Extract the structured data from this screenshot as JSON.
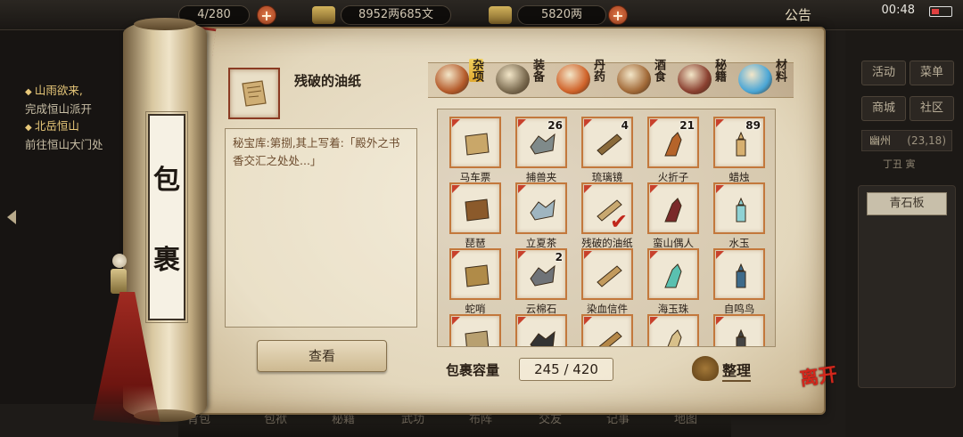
{
  "topbar": {
    "bag_count": "4/280",
    "money": "8952两685文",
    "gold": "5820两",
    "notice": "公告",
    "clock": "00:48"
  },
  "quests": [
    {
      "title": "山雨欲来,",
      "desc": "完成恒山派开"
    },
    {
      "title": "北岳恒山",
      "desc": "前往恒山大门处"
    }
  ],
  "side_buttons": [
    "活动",
    "菜单",
    "商城",
    "社区"
  ],
  "location": {
    "name": "幽州",
    "coord": "(23,18)",
    "time": "丁丑 寅"
  },
  "side_item": "青石板",
  "bottom_tabs": [
    "背包",
    "包袱",
    "秘籍",
    "武功",
    "布阵",
    "交友",
    "记事",
    "地图"
  ],
  "panel": {
    "title_chars": [
      "包",
      "裹"
    ],
    "selected_item": {
      "name": "残破的油纸",
      "description": "秘宝库:第捌,其上写着:「殿外之书香交汇之处处...」",
      "icon": "oil-paper-icon"
    },
    "view_button": "查看",
    "capacity_label": "包裹容量",
    "capacity": "245 / 420",
    "sort_button": "整理",
    "leave_button": "离开"
  },
  "categories": [
    {
      "label": "杂项",
      "icon": "jar-icon",
      "color": "#b45a2a",
      "active": true
    },
    {
      "label": "装备",
      "icon": "weapons-icon",
      "color": "#7a6a4f",
      "active": false
    },
    {
      "label": "丹药",
      "icon": "pills-icon",
      "color": "#d0632a",
      "active": false
    },
    {
      "label": "酒食",
      "icon": "food-icon",
      "color": "#a26a38",
      "active": false
    },
    {
      "label": "秘籍",
      "icon": "books-icon",
      "color": "#8a4030",
      "active": false
    },
    {
      "label": "材料",
      "icon": "crystal-icon",
      "color": "#4aa6d6",
      "active": false
    }
  ],
  "items": [
    {
      "label": "马车票",
      "count": "",
      "icon": "ticket-icon",
      "color": "#c9a769"
    },
    {
      "label": "捕兽夹",
      "count": "26",
      "icon": "trap-icon",
      "color": "#7f8a8a"
    },
    {
      "label": "琉璃镜",
      "count": "4",
      "icon": "telescope-icon",
      "color": "#8a6a3a"
    },
    {
      "label": "火折子",
      "count": "21",
      "icon": "fire-starter-icon",
      "color": "#b5642a"
    },
    {
      "label": "蜡烛",
      "count": "89",
      "icon": "candle-icon",
      "color": "#d7b070"
    },
    {
      "label": "琵琶",
      "count": "",
      "icon": "pipa-icon",
      "color": "#8b5a2b"
    },
    {
      "label": "立夏茶",
      "count": "",
      "icon": "tea-icon",
      "color": "#9fb5c0"
    },
    {
      "label": "残破的油纸",
      "count": "",
      "icon": "oil-paper-icon",
      "color": "#c8a870",
      "selected": true
    },
    {
      "label": "蛮山偶人",
      "count": "",
      "icon": "doll-icon",
      "color": "#7a2a2a"
    },
    {
      "label": "水玉",
      "count": "",
      "icon": "water-jade-icon",
      "color": "#8fd2d4"
    },
    {
      "label": "蛇哨",
      "count": "",
      "icon": "whistle-icon",
      "color": "#b08b48"
    },
    {
      "label": "云棉石",
      "count": "2",
      "icon": "stone-icon",
      "color": "#6f7378"
    },
    {
      "label": "染血信件",
      "count": "",
      "icon": "letter-icon",
      "color": "#c29a5c"
    },
    {
      "label": "海玉珠",
      "count": "",
      "icon": "pearl-icon",
      "color": "#5ac0b0"
    },
    {
      "label": "自鸣鸟",
      "count": "",
      "icon": "bird-icon",
      "color": "#3d6a8a"
    },
    {
      "label": "",
      "count": "",
      "icon": "scroll-map-icon",
      "color": "#b8a070"
    },
    {
      "label": "",
      "count": "",
      "icon": "feather-icon",
      "color": "#333"
    },
    {
      "label": "",
      "count": "",
      "icon": "pouch-icon",
      "color": "#b58848"
    },
    {
      "label": "",
      "count": "",
      "icon": "paper-icon",
      "color": "#d8c08a"
    },
    {
      "label": "",
      "count": "",
      "icon": "dark-item-icon",
      "color": "#444"
    }
  ]
}
